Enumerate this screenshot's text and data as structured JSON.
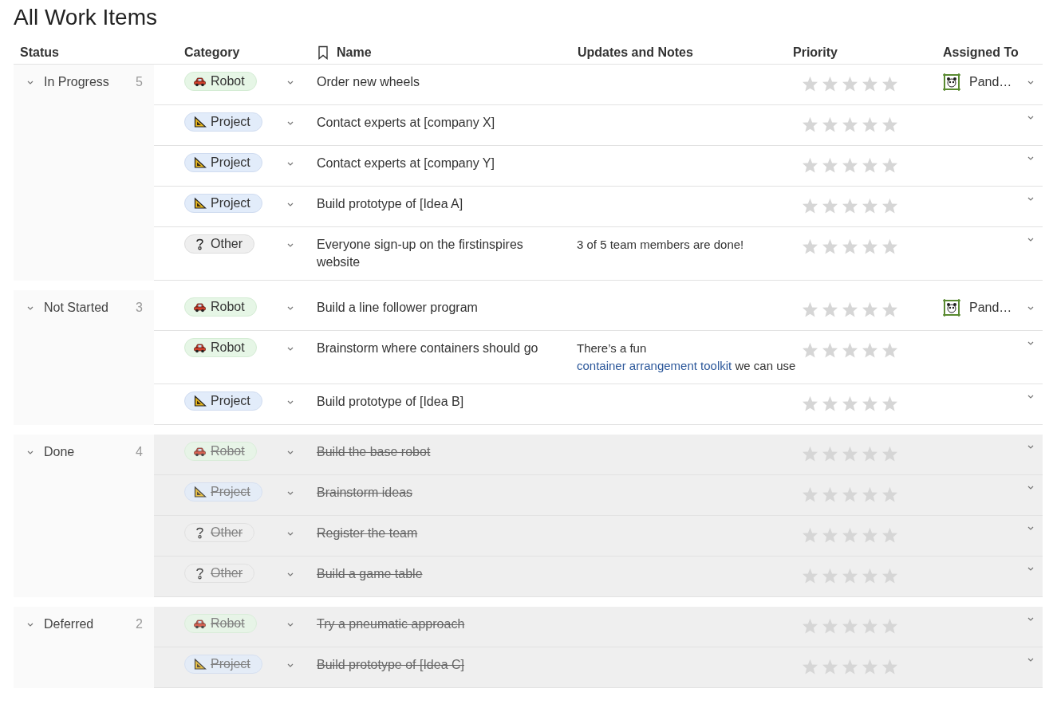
{
  "title": "All Work Items",
  "columns": [
    "Status",
    "Category",
    "Name",
    "Updates and Notes",
    "Priority",
    "Assigned To"
  ],
  "groups": [
    {
      "status": "In Progress",
      "count": "5",
      "expanded": true,
      "rows": [
        {
          "category": {
            "kind": "robot",
            "label": "Robot"
          },
          "name": "Order new wheels",
          "stars": 0,
          "done": false,
          "assignee": "Pand…"
        },
        {
          "category": {
            "kind": "project",
            "label": "Project"
          },
          "name": "Contact experts at [company X]",
          "stars": 0,
          "done": false
        },
        {
          "category": {
            "kind": "project",
            "label": "Project"
          },
          "name": "Contact experts at [company Y]",
          "stars": 0,
          "done": false
        },
        {
          "category": {
            "kind": "project",
            "label": "Project"
          },
          "name": "Build prototype of [Idea A]",
          "stars": 0,
          "done": false
        },
        {
          "category": {
            "kind": "other",
            "label": "Other"
          },
          "name": "Everyone sign-up on the firstinspires website",
          "notes": [
            {
              "text": "3 of 5 team members are done!"
            }
          ],
          "stars": 0,
          "done": false
        }
      ]
    },
    {
      "status": "Not Started",
      "count": "3",
      "expanded": true,
      "rows": [
        {
          "category": {
            "kind": "robot",
            "label": "Robot"
          },
          "name": "Build a line follower program",
          "stars": 0,
          "done": false,
          "assignee": "Pand…"
        },
        {
          "category": {
            "kind": "robot",
            "label": "Robot"
          },
          "name": "Brainstorm where containers should go",
          "notes": [
            {
              "text": "There’s a fun "
            },
            {
              "text": "container arrangement toolkit",
              "link": true
            },
            {
              "text": " we can use"
            }
          ],
          "stars": 0,
          "done": false
        },
        {
          "category": {
            "kind": "project",
            "label": "Project"
          },
          "name": "Build prototype of [Idea B]",
          "stars": 0,
          "done": false
        }
      ]
    },
    {
      "status": "Done",
      "count": "4",
      "expanded": true,
      "rows": [
        {
          "category": {
            "kind": "robot",
            "label": "Robot"
          },
          "name": "Build the base robot",
          "stars": 0,
          "done": true
        },
        {
          "category": {
            "kind": "project",
            "label": "Project"
          },
          "name": "Brainstorm ideas",
          "stars": 0,
          "done": true
        },
        {
          "category": {
            "kind": "other",
            "label": "Other"
          },
          "name": "Register the team",
          "stars": 0,
          "done": true
        },
        {
          "category": {
            "kind": "other",
            "label": "Other"
          },
          "name": "Build a game table",
          "stars": 0,
          "done": true
        }
      ]
    },
    {
      "status": "Deferred",
      "count": "2",
      "expanded": true,
      "rows": [
        {
          "category": {
            "kind": "robot",
            "label": "Robot"
          },
          "name": "Try a pneumatic approach",
          "stars": 0,
          "done": true
        },
        {
          "category": {
            "kind": "project",
            "label": "Project"
          },
          "name": "Build prototype of [Idea C]",
          "stars": 0,
          "done": true
        }
      ]
    }
  ]
}
